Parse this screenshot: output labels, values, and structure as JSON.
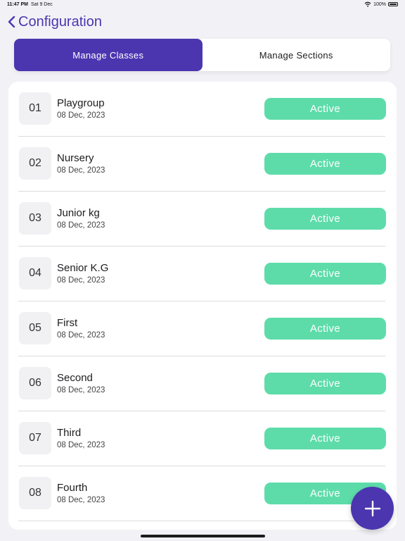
{
  "status_bar": {
    "time": "11:47 PM",
    "date": "Sat 9 Dec",
    "battery": "100%"
  },
  "nav": {
    "title": "Configuration"
  },
  "segments": [
    {
      "label": "Manage Classes",
      "active": true
    },
    {
      "label": "Manage Sections",
      "active": false
    }
  ],
  "classes": [
    {
      "num": "01",
      "name": "Playgroup",
      "date": "08 Dec, 2023",
      "status": "Active"
    },
    {
      "num": "02",
      "name": "Nursery",
      "date": "08 Dec, 2023",
      "status": "Active"
    },
    {
      "num": "03",
      "name": "Junior kg",
      "date": "08 Dec, 2023",
      "status": "Active"
    },
    {
      "num": "04",
      "name": "Senior K.G",
      "date": "08 Dec, 2023",
      "status": "Active"
    },
    {
      "num": "05",
      "name": "First",
      "date": "08 Dec, 2023",
      "status": "Active"
    },
    {
      "num": "06",
      "name": "Second",
      "date": "08 Dec, 2023",
      "status": "Active"
    },
    {
      "num": "07",
      "name": "Third",
      "date": "08 Dec, 2023",
      "status": "Active"
    },
    {
      "num": "08",
      "name": "Fourth",
      "date": "08 Dec, 2023",
      "status": "Active"
    }
  ],
  "icons": {
    "back": "chevron-left-icon",
    "add": "plus-icon",
    "wifi": "wifi-icon",
    "battery": "battery-icon"
  },
  "colors": {
    "accent": "#4b36b0",
    "active_badge": "#5ddcaa"
  }
}
